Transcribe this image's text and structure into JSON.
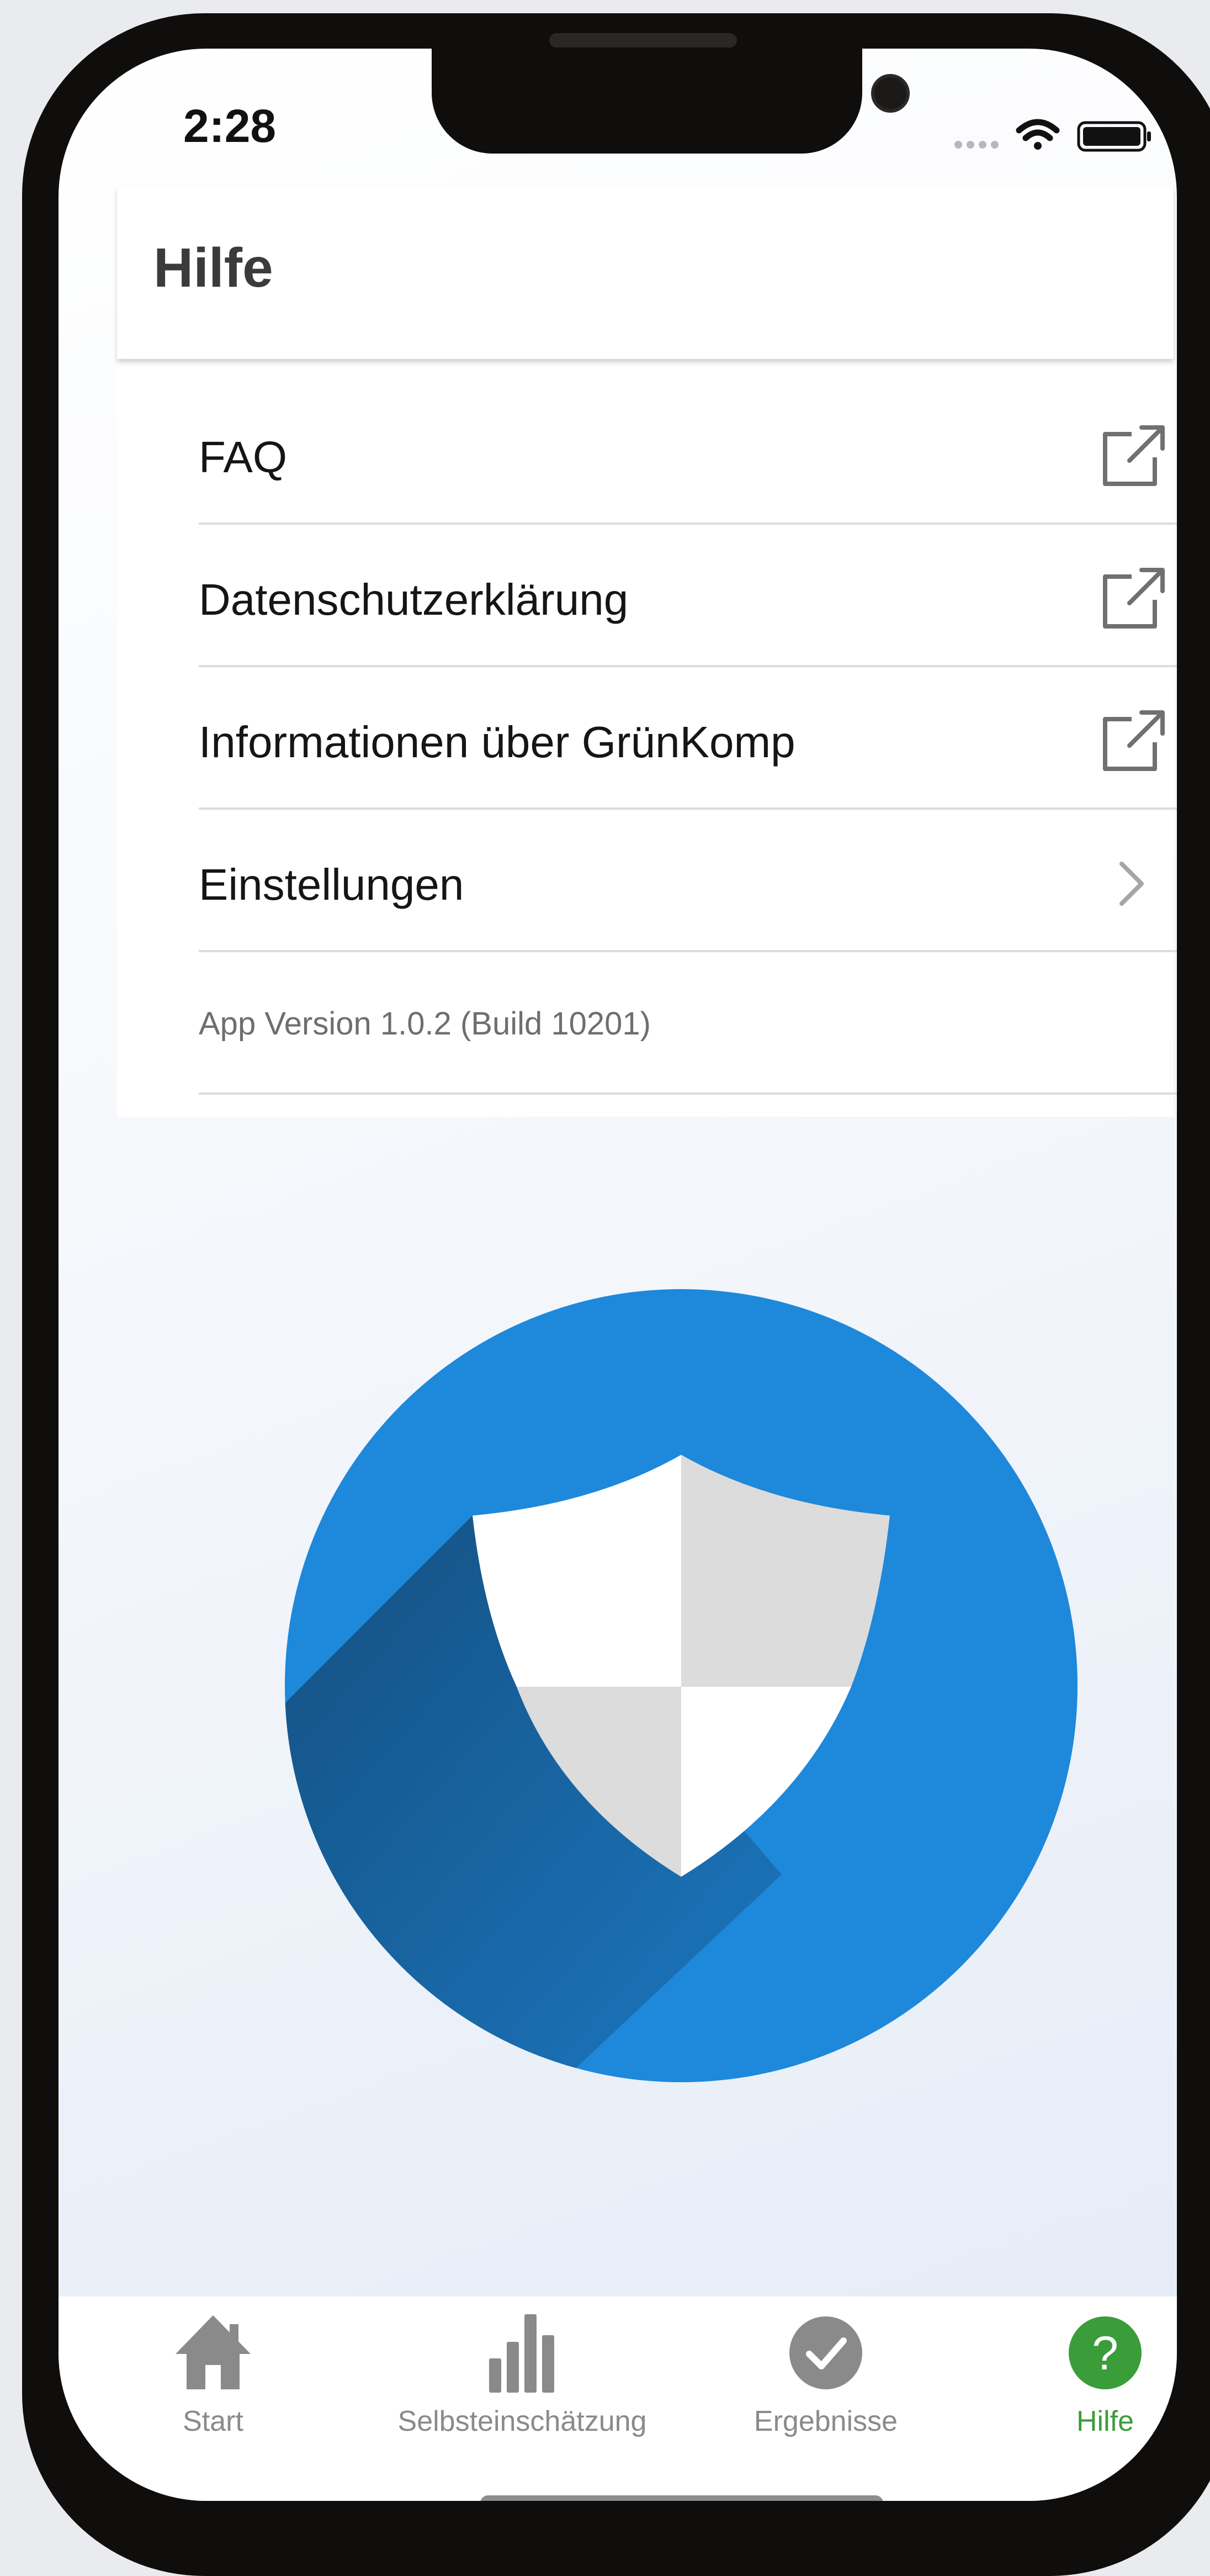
{
  "status_bar": {
    "time": "2:28",
    "icons": [
      "signal-dots-icon",
      "wifi-icon",
      "battery-icon"
    ]
  },
  "header": {
    "title": "Hilfe"
  },
  "menu": {
    "items": [
      {
        "label": "FAQ",
        "icon": "external-link-icon"
      },
      {
        "label": "Datenschutzerklärung",
        "icon": "external-link-icon"
      },
      {
        "label": "Informationen über GrünKomp",
        "icon": "external-link-icon"
      },
      {
        "label": "Einstellungen",
        "icon": "chevron-right-icon"
      }
    ],
    "version": "App Version 1.0.2 (Build 10201)"
  },
  "hero": {
    "icon": "shield-logo-icon",
    "colors": {
      "circle": "#1e88db",
      "shadow": "#15507f",
      "shield_light": "#ffffff",
      "shield_dark": "#dcdcdc"
    }
  },
  "tabbar": {
    "tabs": [
      {
        "label": "Start",
        "icon": "home-icon",
        "active": false
      },
      {
        "label": "Selbsteinschätzung",
        "icon": "bar-chart-icon",
        "active": false
      },
      {
        "label": "Ergebnisse",
        "icon": "checkmark-circle-icon",
        "active": false
      },
      {
        "label": "Hilfe",
        "icon": "help-circle-icon",
        "active": true
      }
    ],
    "colors": {
      "inactive": "#8a8a8a",
      "active": "#3b9d3a"
    }
  }
}
